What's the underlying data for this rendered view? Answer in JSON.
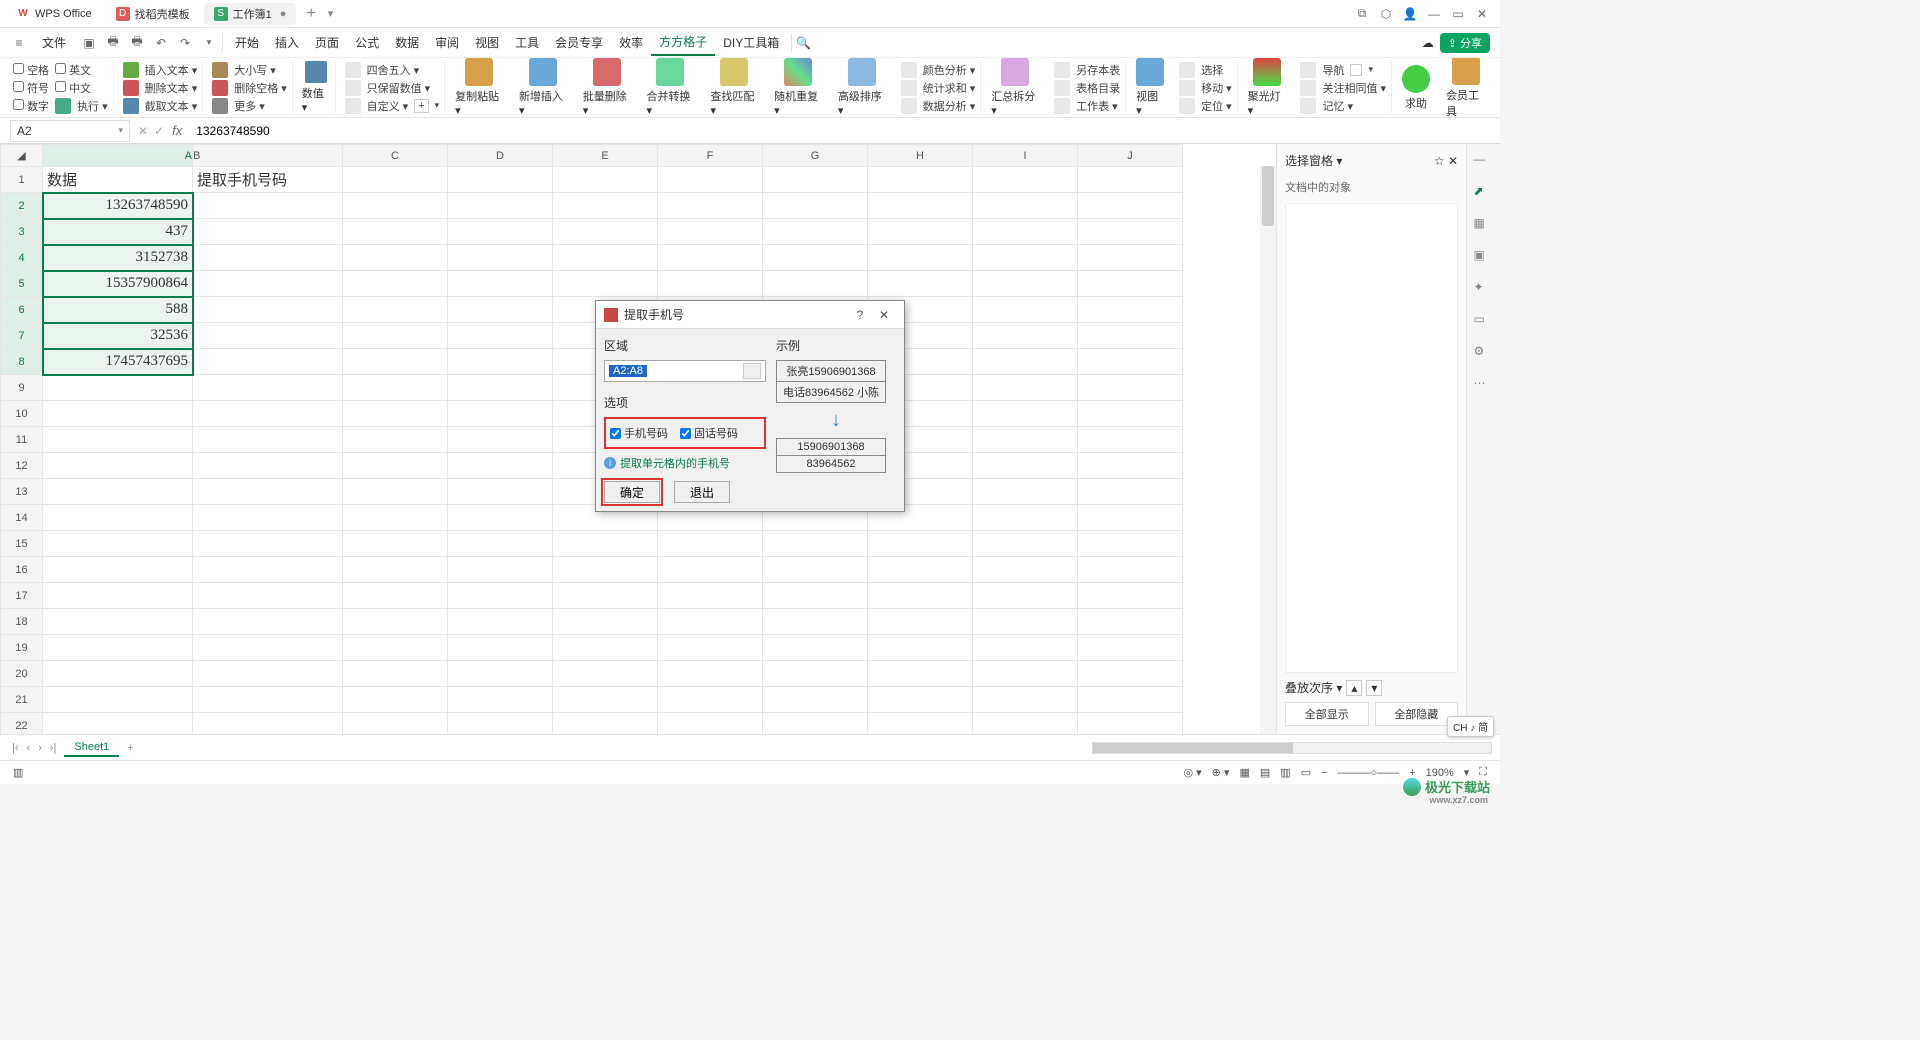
{
  "titlebar": {
    "tabs": [
      {
        "icon_color": "#d94b3a",
        "label": "WPS Office"
      },
      {
        "icon_color": "#e05a5a",
        "label": "找稻壳模板"
      },
      {
        "icon_color": "#3aa76d",
        "label": "工作簿1",
        "active": true
      }
    ]
  },
  "menubar": {
    "file": "文件",
    "items": [
      "开始",
      "插入",
      "页面",
      "公式",
      "数据",
      "审阅",
      "视图",
      "工具",
      "会员专享",
      "效率",
      "方方格子",
      "DIY工具箱"
    ],
    "active_index": 10,
    "share": "分享"
  },
  "ribbon": {
    "g1": [
      [
        "空格",
        "英文"
      ],
      [
        "符号",
        "中文"
      ],
      [
        "数字",
        "执行 ▾"
      ]
    ],
    "g2": [
      "插入文本 ▾",
      "删除文本 ▾",
      "截取文本 ▾"
    ],
    "g3": [
      "大小写 ▾",
      "删除空格 ▾",
      "更多 ▾"
    ],
    "g4_top": "数值 ▾",
    "g4": [
      "四舍五入 ▾",
      "只保留数值 ▾",
      "自定义 ▾"
    ],
    "big": [
      "复制粘贴 ▾",
      "新增插入 ▾",
      "批量删除 ▾",
      "合并转换 ▾",
      "查找匹配 ▾",
      "随机重复 ▾",
      "高级排序 ▾"
    ],
    "g5": [
      "颜色分析 ▾",
      "统计求和 ▾",
      "数据分析 ▾"
    ],
    "big2": "汇总拆分 ▾",
    "g6": [
      "另存本表",
      "表格目录",
      "工作表 ▾"
    ],
    "big3": "视图 ▾",
    "g7": [
      "选择",
      "移动 ▾",
      "定位 ▾"
    ],
    "big4": "聚光灯 ▾",
    "g8": [
      "导航",
      "关注相同值 ▾",
      "记忆 ▾"
    ],
    "big5": [
      "求助",
      "会员工具"
    ]
  },
  "formula": {
    "cellref": "A2",
    "value": "13263748590"
  },
  "grid": {
    "columns": [
      "A",
      "B",
      "C",
      "D",
      "E",
      "F",
      "G",
      "H",
      "I",
      "J"
    ],
    "row_headers": [
      1,
      2,
      3,
      4,
      5,
      6,
      7,
      8,
      9,
      10,
      11,
      12,
      13,
      14,
      15,
      16,
      17,
      18,
      19,
      20,
      21,
      22
    ],
    "header": [
      "数据",
      "提取手机号码"
    ],
    "data": [
      "13263748590",
      "437",
      "3152738",
      "15357900864",
      "588",
      "32536",
      "17457437695"
    ]
  },
  "dialog": {
    "title": "提取手机号",
    "region_label": "区域",
    "range": "A2:A8",
    "options_label": "选项",
    "opt1": "手机号码",
    "opt2": "固话号码",
    "hint": "提取单元格内的手机号",
    "ok": "确定",
    "cancel": "退出",
    "example_label": "示例",
    "ex_in": [
      "张亮15906901368",
      "电话83964562  小陈"
    ],
    "ex_out": [
      "15906901368",
      "83964562"
    ]
  },
  "rightpanel": {
    "title": "选择窗格 ▾",
    "subtitle": "文档中的对象",
    "stack": "叠放次序 ▾",
    "show_all": "全部显示",
    "hide_all": "全部隐藏"
  },
  "sheetbar": {
    "name": "Sheet1"
  },
  "statusbar": {
    "zoom": "190%",
    "ime": "CH ♪ 简"
  },
  "watermark": {
    "text": "极光下载站",
    "url": "www.xz7.com"
  }
}
